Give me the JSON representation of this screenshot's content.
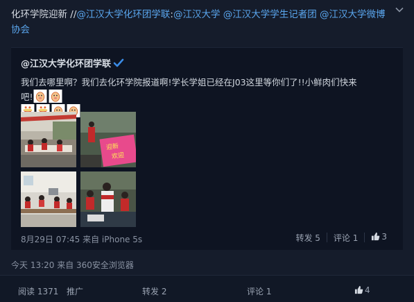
{
  "post": {
    "text_plain": "化环学院迎新 //",
    "mentions": [
      "@江汉大学化环团学联",
      ":",
      "@江汉大学",
      " ",
      "@江汉大学学生记者团",
      " ",
      "@江汉大学微博协会"
    ]
  },
  "repost": {
    "author": "@江汉大学化环团学联",
    "text": "我们去哪里啊？我们去化环学院报道啊!学长学姐已经在J03这里等你们了!!小鲜肉们快来吧!",
    "emojis": [
      "pig-emoji",
      "pig-emoji",
      "bowl-emoji",
      "bowl-emoji",
      "pig-emoji",
      "pig-emoji"
    ],
    "images": [
      {
        "name": "photo-registration-desk"
      },
      {
        "name": "photo-welcome-banner"
      },
      {
        "name": "photo-classroom"
      },
      {
        "name": "photo-students-table"
      }
    ],
    "meta": "8月29日 07:45 来自 iPhone 5s",
    "actions": {
      "forward": "转发 5",
      "comment": "评论 1",
      "like": "3"
    }
  },
  "post_meta": "今天 13:20 来自 360安全浏览器",
  "bottom_bar": {
    "read": "阅读 1371",
    "promote": "推广",
    "forward": "转发 2",
    "comment": "评论 1",
    "like": "4"
  },
  "colors": {
    "background": "#151c2b",
    "link": "#5aa6ee",
    "verified": "#3a8be5"
  }
}
